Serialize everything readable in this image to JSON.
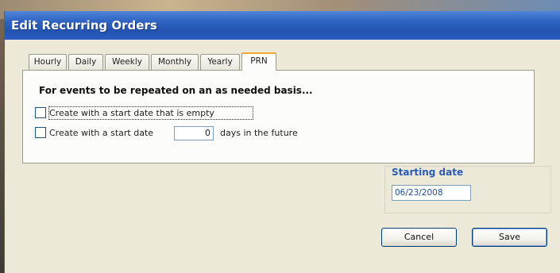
{
  "window": {
    "title": "Edit Recurring Orders"
  },
  "tabs": [
    {
      "label": "Hourly"
    },
    {
      "label": "Daily"
    },
    {
      "label": "Weekly"
    },
    {
      "label": "Monthly"
    },
    {
      "label": "Yearly"
    },
    {
      "label": "PRN",
      "active": true
    }
  ],
  "prn_panel": {
    "heading": "For events to be repeated on an as needed basis...",
    "option_empty_start": {
      "label": "Create with a start date that is empty",
      "checked": false
    },
    "option_future_start": {
      "label_before": "Create with a start date",
      "days_value": "0",
      "label_after": "days in the future",
      "checked": false
    }
  },
  "starting_date": {
    "label": "Starting date",
    "value": "06/23/2008"
  },
  "buttons": {
    "cancel": "Cancel",
    "save": "Save"
  },
  "colors": {
    "titlebar": "#2f64c2",
    "active_tab_accent": "#f2a930",
    "group_label": "#2a5bb5"
  }
}
